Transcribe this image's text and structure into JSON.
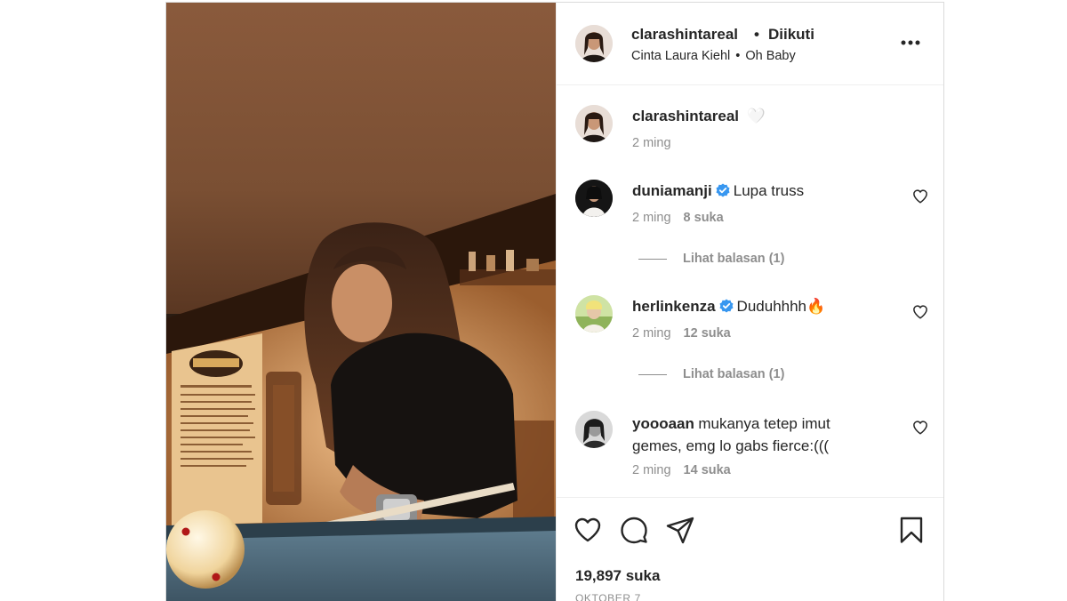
{
  "header": {
    "username": "clarashintareal",
    "separator": "•",
    "follow_status": "Diikuti",
    "artist": "Cinta Laura Kiehl",
    "song_separator": "•",
    "song": "Oh Baby",
    "more_icon": "more-horizontal-icon"
  },
  "caption": {
    "username": "clarashintareal",
    "text": "🤍",
    "time": "2 ming"
  },
  "comments": [
    {
      "username": "duniamanji",
      "verified": true,
      "text": "Lupa truss",
      "time": "2 ming",
      "likes": "8 suka",
      "replies": "Lihat balasan (1)"
    },
    {
      "username": "herlinkenza",
      "verified": true,
      "text": "Duduhhhh🔥",
      "time": "2 ming",
      "likes": "12 suka",
      "replies": "Lihat balasan (1)"
    },
    {
      "username": "yoooaan",
      "verified": false,
      "text": "mukanya tetep imut",
      "text_line2": "gemes, emg lo gabs fierce:(((",
      "time": "2 ming",
      "likes": "14 suka"
    }
  ],
  "footer": {
    "likes": "19,897 suka",
    "date": "OKTOBER 7",
    "icons": [
      "heart-icon",
      "comment-icon",
      "share-icon",
      "bookmark-icon"
    ]
  },
  "colors": {
    "text": "#262626",
    "secondary": "#8e8e8e",
    "border": "#dbdbdb",
    "verified": "#3897f0"
  }
}
